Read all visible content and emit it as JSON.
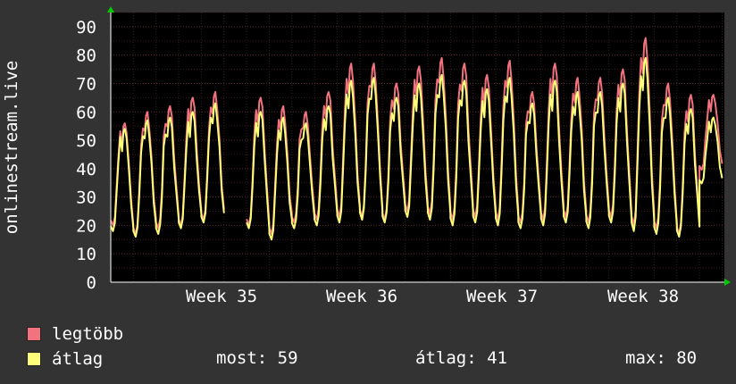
{
  "colors": {
    "background": "#333333",
    "plot_background": "#000000",
    "grid_minor": "#3a1d1d",
    "grid_major": "#5a2a2a",
    "axis": "#ffffff",
    "series_max": "#f2737d",
    "series_avg": "#ffff7a",
    "arrow": "#00cc00"
  },
  "chart_data": {
    "type": "line",
    "ylabel": "onlinestream.live",
    "ylim": [
      0,
      95
    ],
    "yticks": [
      0,
      10,
      20,
      30,
      40,
      50,
      60,
      70,
      80,
      90
    ],
    "xticks": [
      "Week 35",
      "Week 36",
      "Week 37",
      "Week 38"
    ],
    "grid": true,
    "days": 27,
    "series": [
      {
        "name": "legtöbb",
        "daily_peak": [
          56,
          60,
          62,
          65,
          67,
          null,
          65,
          62,
          60,
          67,
          77,
          77,
          70,
          76,
          79,
          77,
          73,
          78,
          67,
          77,
          72,
          72,
          75,
          86,
          70,
          66,
          66
        ],
        "daily_low": [
          20,
          17,
          19,
          20,
          22,
          null,
          20,
          17,
          21,
          22,
          23,
          23,
          22,
          25,
          24,
          22,
          23,
          22,
          21,
          22,
          23,
          21,
          23,
          20,
          19,
          17,
          null
        ]
      },
      {
        "name": "átlag",
        "daily_peak": [
          54,
          57,
          58,
          60,
          63,
          null,
          60,
          58,
          56,
          62,
          71,
          72,
          65,
          70,
          73,
          71,
          68,
          72,
          63,
          71,
          67,
          67,
          70,
          79,
          65,
          61,
          58
        ],
        "daily_low": [
          18,
          16,
          17,
          19,
          21,
          null,
          19,
          15,
          19,
          20,
          21,
          22,
          21,
          23,
          22,
          20,
          21,
          20,
          19,
          20,
          21,
          19,
          21,
          18,
          17,
          16,
          null
        ]
      }
    ]
  },
  "legend": {
    "max_label": "legtöbb",
    "avg_label": "átlag",
    "now": "most: 59",
    "avg": "átlag: 41",
    "max": "max: 80"
  }
}
